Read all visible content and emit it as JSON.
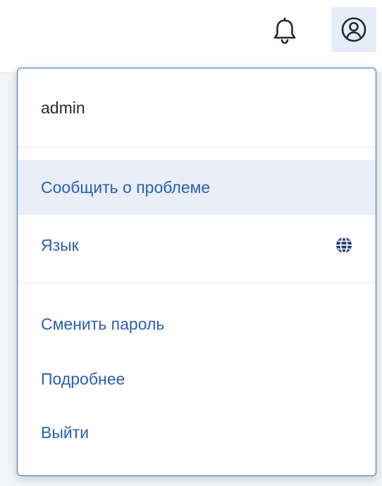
{
  "topbar": {
    "icons": [
      "bell-icon",
      "user-circle-icon"
    ]
  },
  "menu": {
    "username": "admin",
    "items": [
      {
        "label": "Сообщить о проблеме",
        "active": true
      },
      {
        "label": "Язык",
        "icon": "globe-icon"
      },
      {
        "label": "Сменить пароль"
      },
      {
        "label": "Подробнее"
      },
      {
        "label": "Выйти"
      }
    ]
  },
  "colors": {
    "accent": "#2a5fb0",
    "menu_border": "#2f6fc9",
    "active_bg": "#e9eef8",
    "user_button_bg": "#e6edf8"
  }
}
